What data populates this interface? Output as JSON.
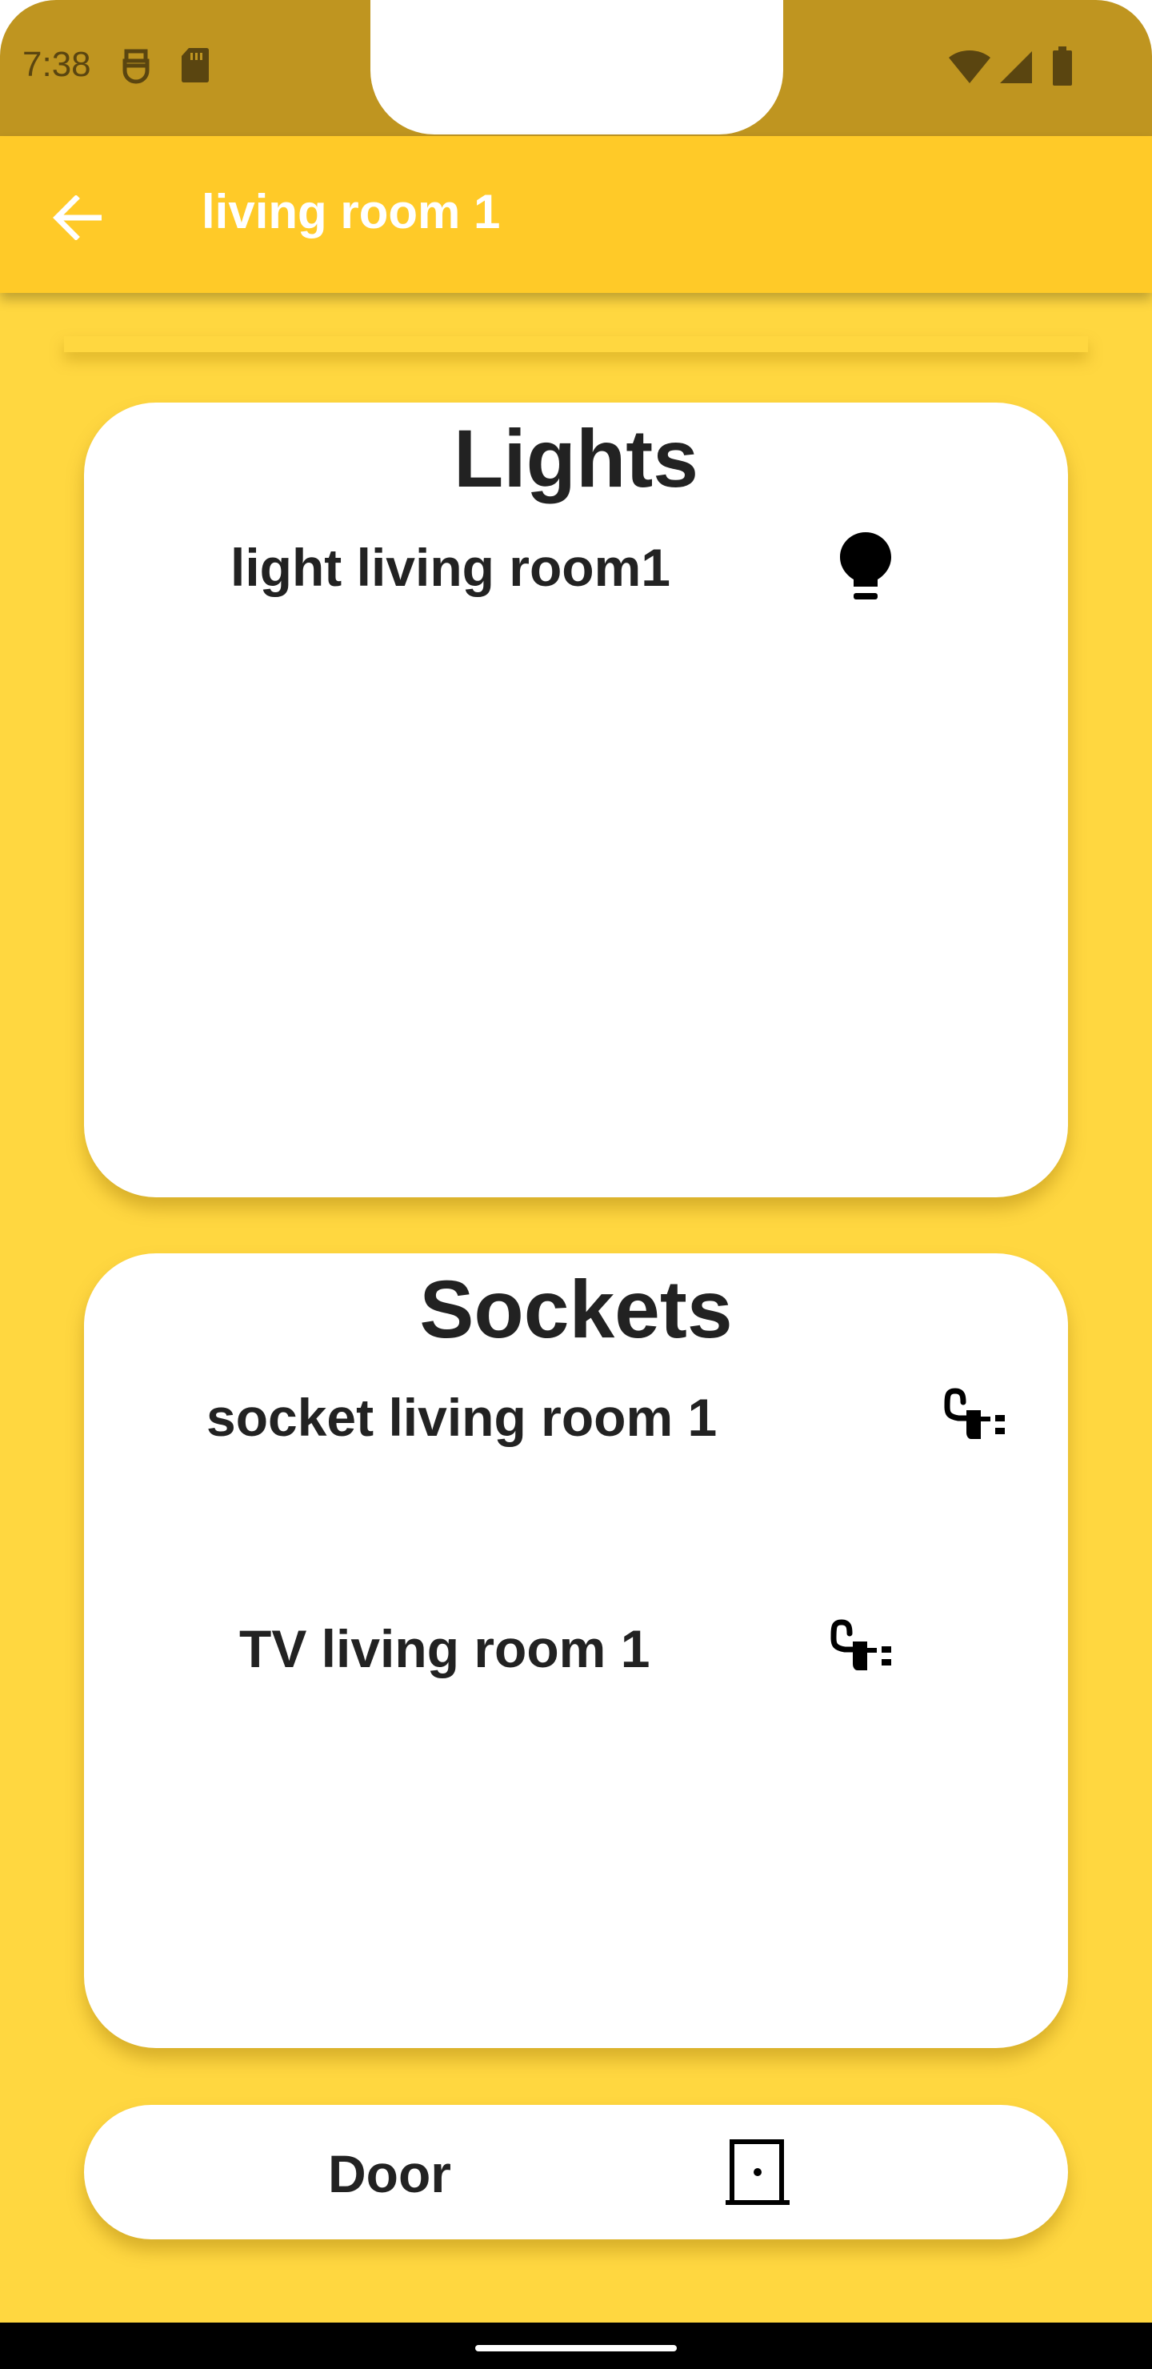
{
  "status_bar": {
    "time": "7:38",
    "icons_left": [
      "alien-notification-icon",
      "sd-card-icon"
    ],
    "icons_right": [
      "wifi-icon",
      "cell-signal-icon",
      "battery-icon"
    ]
  },
  "app_bar": {
    "title": "living room 1",
    "back_icon": "arrow-back-icon"
  },
  "lights": {
    "title": "Lights",
    "items": [
      {
        "label": "light living room1",
        "icon": "lightbulb-icon"
      }
    ]
  },
  "sockets": {
    "title": "Sockets",
    "items": [
      {
        "label": "socket living room 1",
        "icon": "power-plug-icon"
      },
      {
        "label": "TV living room 1",
        "icon": "power-plug-icon"
      }
    ]
  },
  "door": {
    "label": "Door",
    "icon": "door-icon"
  },
  "colors": {
    "background": "#FFD740",
    "app_bar": "#FFCA28",
    "status_bar": "#BF9520",
    "card": "#FFFFFF",
    "text": "#222222"
  }
}
